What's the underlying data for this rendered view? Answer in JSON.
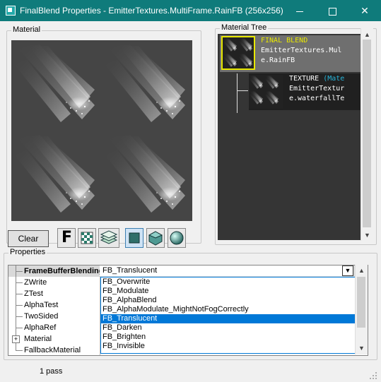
{
  "window": {
    "title": "FinalBlend Properties - EmitterTextures.MultiFrame.RainFB (256x256)"
  },
  "material": {
    "label": "Material",
    "clear_label": "Clear",
    "tools": [
      "F",
      "checker",
      "layers",
      "cube-flat",
      "cube-shaded",
      "sphere"
    ]
  },
  "tree": {
    "label": "Material Tree",
    "nodes": [
      {
        "type": "FINAL BLEND",
        "lines": [
          "EmitterTextures.Mul",
          "e.RainFB"
        ]
      },
      {
        "type": "TEXTURE",
        "type_suffix": "(Mate",
        "lines": [
          "EmitterTextur",
          "e.waterfallTe"
        ]
      }
    ]
  },
  "properties": {
    "label": "Properties",
    "rows": [
      {
        "name": "FrameBufferBlending",
        "bold": true
      },
      {
        "name": "ZWrite"
      },
      {
        "name": "ZTest"
      },
      {
        "name": "AlphaTest"
      },
      {
        "name": "TwoSided"
      },
      {
        "name": "AlphaRef"
      },
      {
        "name": "Material",
        "expander": "+"
      },
      {
        "name": "FallbackMaterial"
      }
    ],
    "current_value": "FB_Translucent",
    "options": [
      "FB_Overwrite",
      "FB_Modulate",
      "FB_AlphaBlend",
      "FB_AlphaModulate_MightNotFogCorrectly",
      "FB_Translucent",
      "FB_Darken",
      "FB_Brighten",
      "FB_Invisible"
    ],
    "selected_option": "FB_Translucent"
  },
  "status": {
    "text": "1 pass"
  },
  "colors": {
    "titlebar": "#0f7b7b",
    "selection": "#0078d7",
    "tree_bg": "#353535",
    "tree_type": "#e8e800",
    "tree_text": "#ffffff"
  }
}
